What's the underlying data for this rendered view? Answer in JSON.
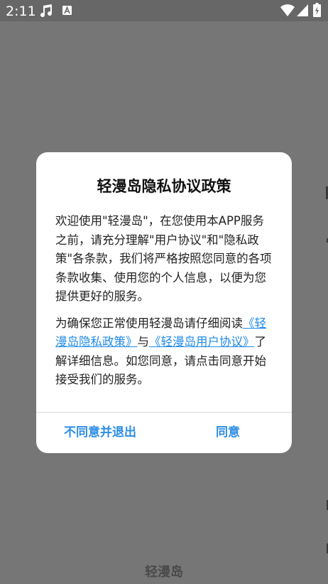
{
  "status_bar": {
    "time": "2:11",
    "icons": [
      "music-note-icon",
      "text-a-icon",
      "wifi-icon",
      "cellular-signal-icon",
      "battery-charging-icon"
    ]
  },
  "background": {
    "app_title": "轻漫岛"
  },
  "dialog": {
    "title": "轻漫岛隐私协议政策",
    "paragraph1": "欢迎使用\"轻漫岛\"，在您使用本APP服务之前，请充分理解\"用户协议\"和\"隐私政策\"各条款，我们将严格按照您同意的各项条款收集、使用您的个人信息，以便为您提供更好的服务。",
    "paragraph2_prefix": "为确保您正常使用轻漫岛请仔细阅读",
    "privacy_link": "《轻漫岛隐私政策》",
    "conjunction": "与",
    "user_agreement_link": "《轻漫岛用户协议》",
    "paragraph2_suffix": "了解详细信息。如您同意，请点击同意开始接受我们的服务。",
    "disagree_label": "不同意并退出",
    "agree_label": "同意"
  },
  "colors": {
    "overlay": "#767676",
    "accent": "#2d8ee6",
    "link": "#1f8ae8"
  }
}
